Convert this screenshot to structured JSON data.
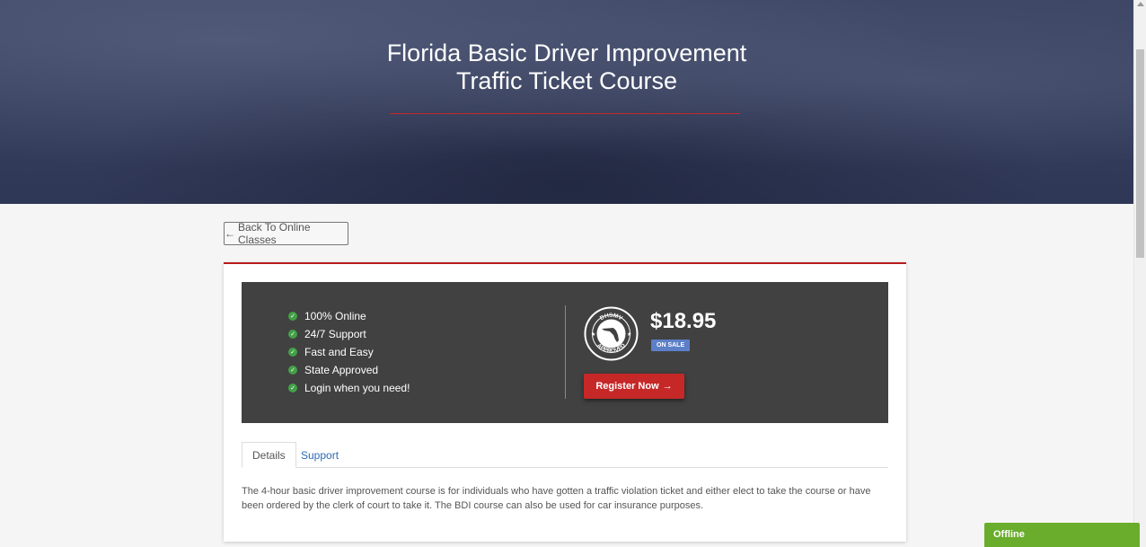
{
  "hero": {
    "title_line1": "Florida Basic Driver Improvement",
    "title_line2": "Traffic Ticket Course"
  },
  "back_button": {
    "arrow": "←",
    "label": "Back To Online Classes"
  },
  "features": [
    "100% Online",
    "24/7 Support",
    "Fast and Easy",
    "State Approved",
    "Login when you need!"
  ],
  "pricing": {
    "price": "$18.95",
    "badge": "ON SALE",
    "register_label": "Register Now",
    "register_arrow": "→"
  },
  "seal": {
    "top_text": "DHSMV",
    "bottom_text": "APPROVED"
  },
  "tabs": [
    {
      "label": "Details",
      "active": true
    },
    {
      "label": "Support",
      "active": false
    }
  ],
  "description": "The 4-hour basic driver improvement course is for individuals who have gotten a traffic violation ticket and either elect to take the course or have been ordered by the clerk of court to take it. The BDI course can also be used for car insurance purposes.",
  "chat": {
    "status": "Offline"
  },
  "colors": {
    "accent_red": "#c62828",
    "panel": "#414141",
    "check_green": "#43a047",
    "chat_green": "#6aad2c",
    "link_blue": "#2d6bb3"
  }
}
